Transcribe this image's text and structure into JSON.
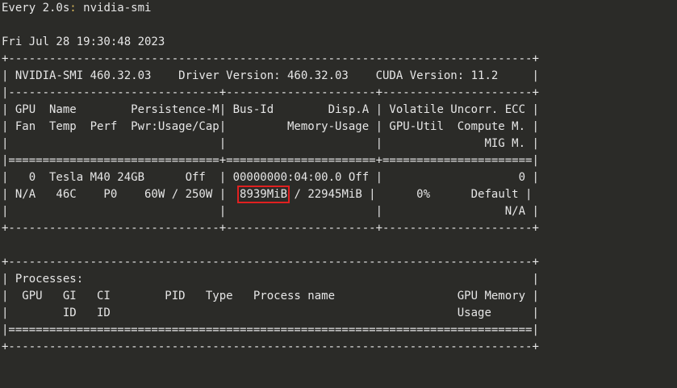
{
  "watch": {
    "interval": "Every 2.0s",
    "colon": ":",
    "command": " nvidia-smi"
  },
  "timestamp": "Fri Jul 28 19:30:48 2023",
  "table": {
    "border_top": "+-----------------------------------------------------------------------------+",
    "version_line": "| NVIDIA-SMI 460.32.03    Driver Version: 460.32.03    CUDA Version: 11.2     |",
    "sep1": "|-------------------------------+----------------------+----------------------+",
    "header1": "| GPU  Name        Persistence-M| Bus-Id        Disp.A | Volatile Uncorr. ECC |",
    "header2": "| Fan  Temp  Perf  Pwr:Usage/Cap|         Memory-Usage | GPU-Util  Compute M. |",
    "header3": "|                               |                      |               MIG M. |",
    "sep_double": "|===============================+======================+======================|",
    "gpu_row1": "|   0  Tesla M40 24GB      Off  | 00000000:04:00.0 Off |                    0 |",
    "gpu_row2_before": "| N/A   46C    P0    60W / 250W |  ",
    "gpu_mem_used": "8939MiB",
    "gpu_row2_after": " / 22945MiB |      0%      Default |",
    "gpu_row3": "|                               |                      |                  N/A |",
    "border_mid": "+-------------------------------+----------------------+----------------------+"
  },
  "processes": {
    "border_top": "+-----------------------------------------------------------------------------+",
    "title_line": "| Processes:                                                                  |",
    "header1": "|  GPU   GI   CI        PID   Type   Process name                  GPU Memory |",
    "header2": "|        ID   ID                                                   Usage      |",
    "sep_double": "|=============================================================================|",
    "border_bottom": "+-----------------------------------------------------------------------------+"
  }
}
